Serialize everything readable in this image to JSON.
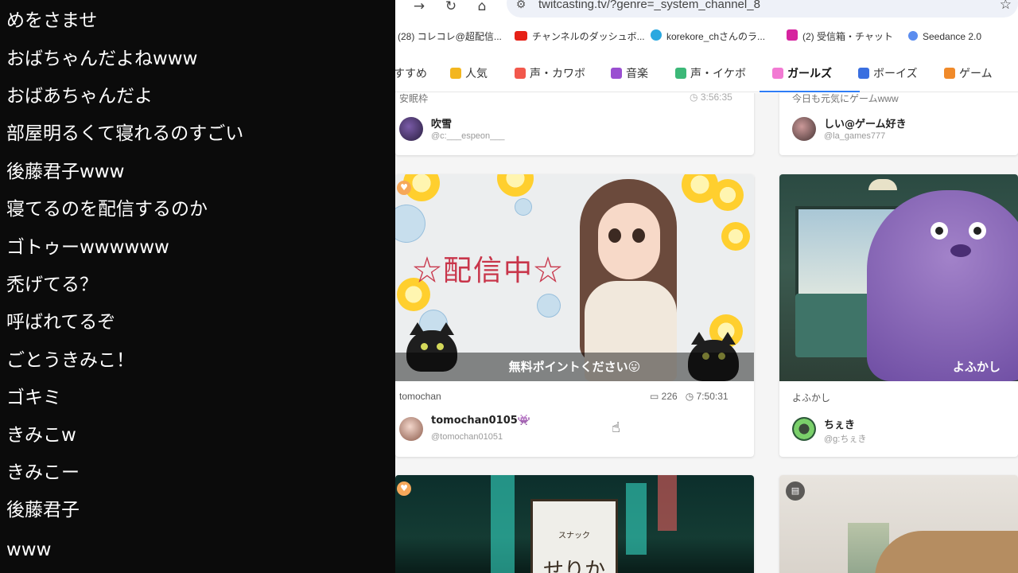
{
  "comments": [
    "めをさませ",
    "おばちゃんだよねwww",
    "おばあちゃんだよ",
    "部屋明るくて寝れるのすごい",
    "後藤君子www",
    "寝てるのを配信するのか",
    "ゴトゥーwwwwww",
    "禿げてる？",
    "呼ばれてるぞ",
    "ごとうきみこ！",
    "ゴキミ",
    "きみこw",
    "きみこー",
    "後藤君子",
    "www"
  ],
  "browser": {
    "url": "twitcasting.tv/?genre=_system_channel_8",
    "bookmarks": [
      {
        "label": "(28) コレコレ@超配信...",
        "color": "#bbbbbb"
      },
      {
        "label": "チャンネルのダッシュボ...",
        "color": "#e62117"
      },
      {
        "label": "korekore_chさんのラ...",
        "color": "#2aa8e0"
      },
      {
        "label": "(2) 受信箱・チャット",
        "color": "#d6249f"
      },
      {
        "label": "Seedance 2.0",
        "color": "#5b8def"
      }
    ]
  },
  "categories": [
    {
      "label": "すすめ",
      "color": "",
      "active": false
    },
    {
      "label": "人気",
      "color": "#f3b61f",
      "active": false
    },
    {
      "label": "声・カワボ",
      "color": "#f2584c",
      "active": false
    },
    {
      "label": "音楽",
      "color": "#9a4fd1",
      "active": false
    },
    {
      "label": "声・イケボ",
      "color": "#3cb878",
      "active": false
    },
    {
      "label": "ガールズ",
      "color": "#f27ad3",
      "active": true
    },
    {
      "label": "ボーイズ",
      "color": "#3a6fe0",
      "active": false
    },
    {
      "label": "ゲーム",
      "color": "#f08a2a",
      "active": false
    }
  ],
  "cards": {
    "top_left": {
      "meta": "安眠枠",
      "time": "3:56:35",
      "username": "吹雪",
      "user_id": "@c:___espeon___"
    },
    "top_right": {
      "meta": "今日も元気にゲームwww",
      "username": "しい@ゲーム好き",
      "user_id": "@la_games777"
    },
    "mid_left": {
      "thumb_text": "☆配信中☆",
      "caption": "無料ポイントください😛",
      "meta": "tomochan",
      "comments": "226",
      "time": "7:50:31",
      "username": "tomochan0105👾",
      "user_id": "@tomochan01051"
    },
    "mid_right": {
      "caption": "よふかし",
      "meta": "よふかし",
      "username": "ちぇき",
      "user_id": "@g:ちぇき"
    },
    "bottom_left": {
      "sign_small": "スナック",
      "sign_name": "せりか"
    }
  },
  "icons": {
    "forward": "arrow-right-icon",
    "reload": "reload-icon",
    "home": "home-icon",
    "site_info": "site-info-icon",
    "bookmark": "star-icon",
    "comment": "comment-icon",
    "timer": "timer-icon",
    "cursor": "pointer-cursor-icon"
  }
}
